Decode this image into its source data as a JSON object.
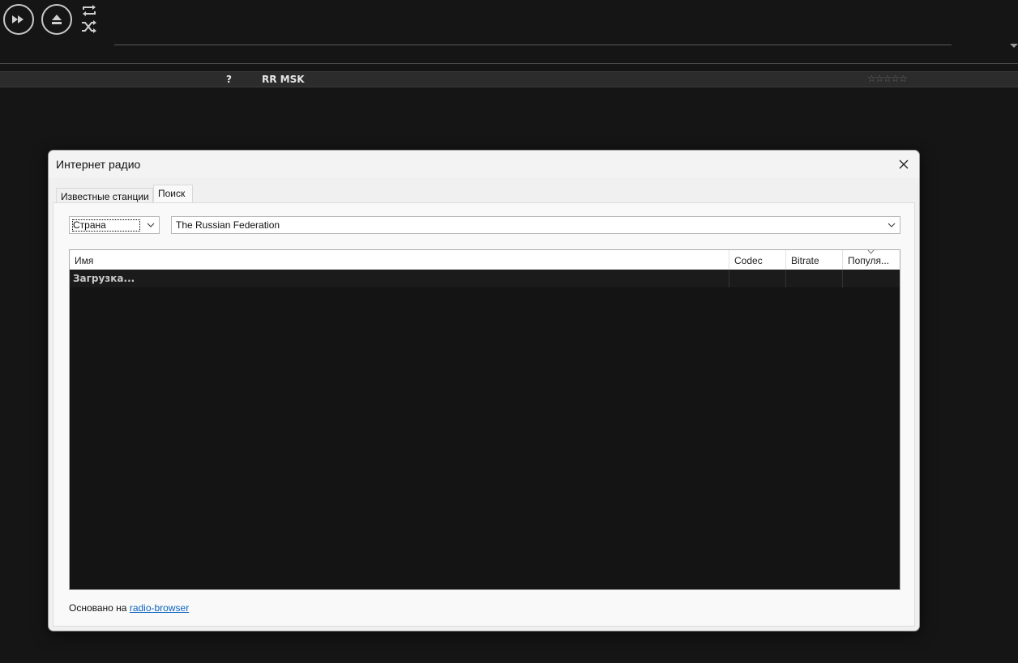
{
  "player": {
    "track": {
      "number": "?",
      "title": "RR MSK",
      "rating": "☆☆☆☆☆"
    }
  },
  "dialog": {
    "title": "Интернет радио",
    "tabs": [
      {
        "label": "Известные станции",
        "active": false
      },
      {
        "label": "Поиск",
        "active": true
      }
    ],
    "filter": {
      "field_value": "Страна",
      "country_value": "The Russian Federation"
    },
    "list": {
      "columns": [
        "Имя",
        "Codec",
        "Bitrate",
        "Популя..."
      ],
      "rows": [
        {
          "name": "Загрузка...",
          "codec": "",
          "bitrate": "",
          "popularity": ""
        }
      ]
    },
    "footer": {
      "text": "Основано на",
      "link_label": "radio-browser"
    }
  }
}
